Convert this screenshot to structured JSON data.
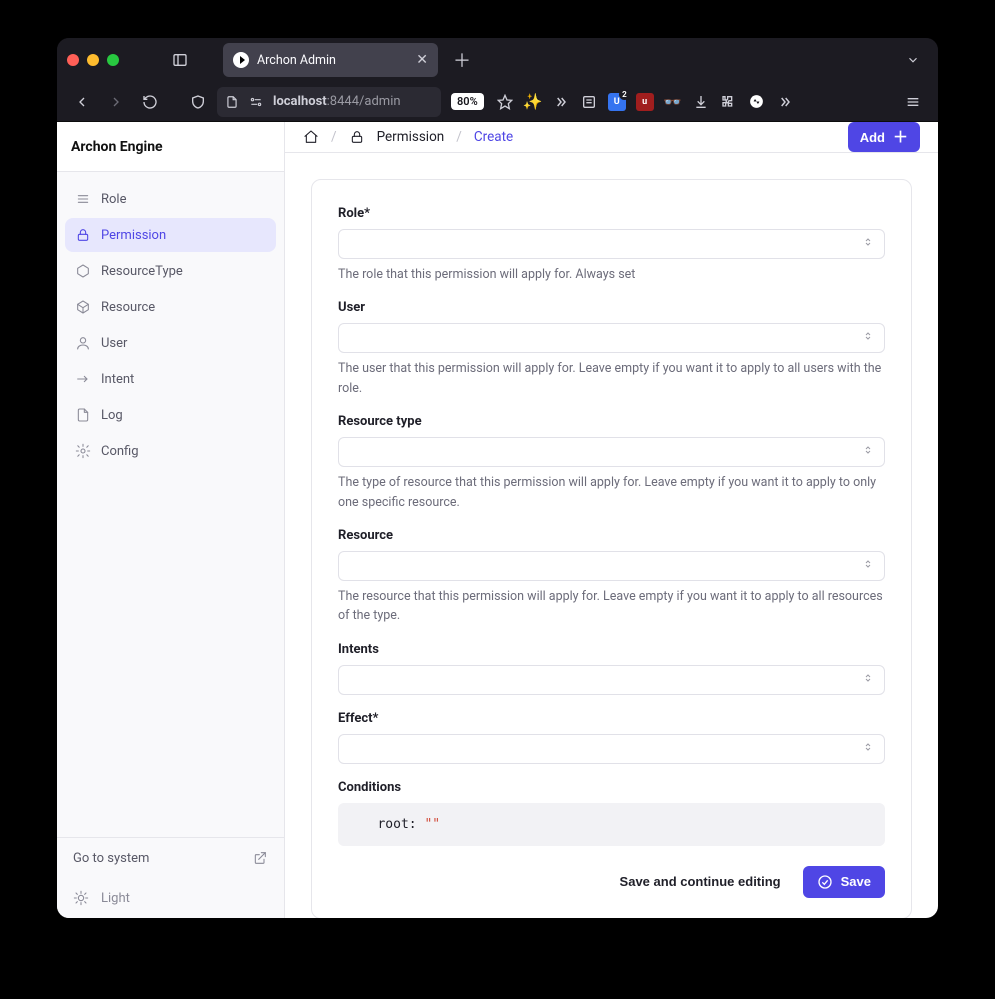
{
  "browser": {
    "tab_title": "Archon Admin",
    "url_host": "localhost",
    "url_rest": ":8444/admin",
    "zoom": "80%",
    "ublock_badge": "2"
  },
  "app": {
    "brand": "Archon Engine",
    "sidebar": {
      "items": [
        {
          "label": "Role",
          "icon": "rows-icon"
        },
        {
          "label": "Permission",
          "icon": "lock-icon",
          "active": true
        },
        {
          "label": "ResourceType",
          "icon": "hex-icon"
        },
        {
          "label": "Resource",
          "icon": "cube-icon"
        },
        {
          "label": "User",
          "icon": "user-icon"
        },
        {
          "label": "Intent",
          "icon": "arrow-icon"
        },
        {
          "label": "Log",
          "icon": "file-icon"
        },
        {
          "label": "Config",
          "icon": "gear-icon"
        }
      ],
      "go_to_system": "Go to system",
      "theme_label": "Light"
    },
    "breadcrumb": {
      "section": "Permission",
      "current": "Create"
    },
    "add_button": "Add",
    "form": {
      "fields": [
        {
          "key": "role",
          "label": "Role*",
          "help": "The role that this permission will apply for. Always set",
          "type": "select"
        },
        {
          "key": "user",
          "label": "User",
          "help": "The user that this permission will apply for. Leave empty if you want it to apply to all users with the role.",
          "type": "select"
        },
        {
          "key": "resource_type",
          "label": "Resource type",
          "help": "The type of resource that this permission will apply for. Leave empty if you want it to apply to only one specific resource.",
          "type": "select"
        },
        {
          "key": "resource",
          "label": "Resource",
          "help": "The resource that this permission will apply for. Leave empty if you want it to apply to all resources of the type.",
          "type": "select"
        },
        {
          "key": "intents",
          "label": "Intents",
          "help": "",
          "type": "select"
        },
        {
          "key": "effect",
          "label": "Effect*",
          "help": "",
          "type": "select"
        },
        {
          "key": "conditions",
          "label": "Conditions",
          "help": "",
          "type": "code",
          "code_prefix": "root: ",
          "code_value": "\"\""
        }
      ],
      "save_continue": "Save and continue editing",
      "save": "Save"
    }
  }
}
